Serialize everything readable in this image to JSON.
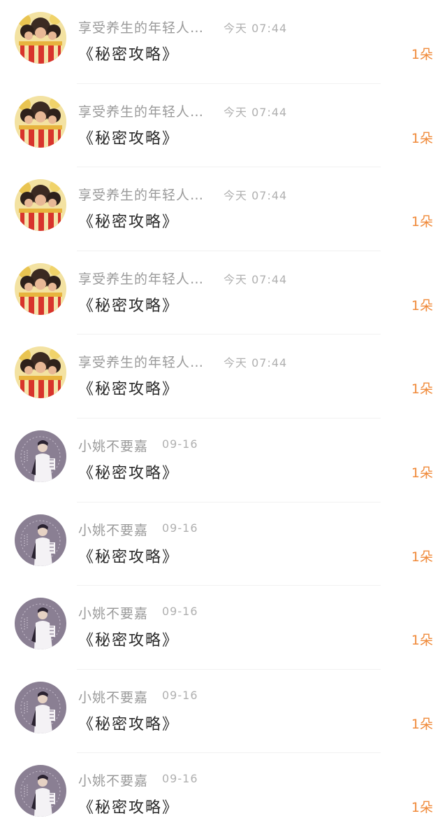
{
  "messages": [
    {
      "sender": "享受养生的年轻人…",
      "time": "今天 07:44",
      "title": "《秘密攻略》",
      "count": "1朵",
      "avatar_icon": "gold-group-avatar-icon"
    },
    {
      "sender": "享受养生的年轻人…",
      "time": "今天 07:44",
      "title": "《秘密攻略》",
      "count": "1朵",
      "avatar_icon": "gold-group-avatar-icon"
    },
    {
      "sender": "享受养生的年轻人…",
      "time": "今天 07:44",
      "title": "《秘密攻略》",
      "count": "1朵",
      "avatar_icon": "gold-group-avatar-icon"
    },
    {
      "sender": "享受养生的年轻人…",
      "time": "今天 07:44",
      "title": "《秘密攻略》",
      "count": "1朵",
      "avatar_icon": "gold-group-avatar-icon"
    },
    {
      "sender": "享受养生的年轻人…",
      "time": "今天 07:44",
      "title": "《秘密攻略》",
      "count": "1朵",
      "avatar_icon": "gold-group-avatar-icon"
    },
    {
      "sender": "小姚不要嘉",
      "time": "09-16",
      "title": "《秘密攻略》",
      "count": "1朵",
      "avatar_icon": "purple-portrait-avatar-icon"
    },
    {
      "sender": "小姚不要嘉",
      "time": "09-16",
      "title": "《秘密攻略》",
      "count": "1朵",
      "avatar_icon": "purple-portrait-avatar-icon"
    },
    {
      "sender": "小姚不要嘉",
      "time": "09-16",
      "title": "《秘密攻略》",
      "count": "1朵",
      "avatar_icon": "purple-portrait-avatar-icon"
    },
    {
      "sender": "小姚不要嘉",
      "time": "09-16",
      "title": "《秘密攻略》",
      "count": "1朵",
      "avatar_icon": "purple-portrait-avatar-icon"
    },
    {
      "sender": "小姚不要嘉",
      "time": "09-16",
      "title": "《秘密攻略》",
      "count": "1朵",
      "avatar_icon": "purple-portrait-avatar-icon"
    }
  ],
  "colors": {
    "sender_text": "#9a9a9a",
    "time_text": "#b0b0b0",
    "title_text": "#2a2a2a",
    "count_accent": "#f08a3a",
    "divider": "#f1f1f1"
  }
}
